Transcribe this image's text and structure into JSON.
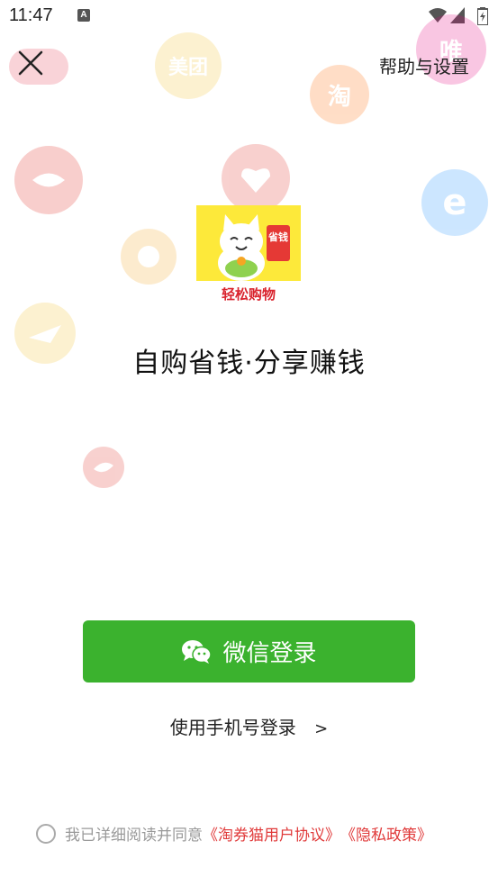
{
  "status_bar": {
    "time": "11:47",
    "notification": "A"
  },
  "header": {
    "help_label": "帮助与设置"
  },
  "background_icons": [
    {
      "name": "meituan-icon",
      "text": "美团",
      "color": "#f2c12e"
    },
    {
      "name": "taobao-icon",
      "text": "淘",
      "color": "#ff6a00"
    },
    {
      "name": "vip-icon",
      "text": "唯",
      "color": "#e6007e"
    },
    {
      "name": "jd-icon",
      "text": "",
      "color": "#e1251b"
    },
    {
      "name": "pinduoduo-icon",
      "text": "",
      "color": "#e02e24"
    },
    {
      "name": "eleme-icon",
      "text": "e",
      "color": "#1e90ff"
    },
    {
      "name": "suning-icon",
      "text": "",
      "color": "#f5a623"
    },
    {
      "name": "fliggy-icon",
      "text": "",
      "color": "#f2c12e"
    },
    {
      "name": "bird-icon",
      "text": "",
      "color": "#e02e24"
    }
  ],
  "logo": {
    "top_text": "省钱",
    "caption": "轻松购物"
  },
  "slogan": "自购省钱·分享赚钱",
  "wechat_login": {
    "label": "微信登录"
  },
  "phone_login": {
    "label": "使用手机号登录",
    "arrow": ">"
  },
  "agreement": {
    "text": "我已详细阅读并同意",
    "user_agreement": "《淘券猫用户协议》",
    "privacy_policy": "《隐私政策》"
  },
  "colors": {
    "wechat_green": "#3bb22e",
    "link_red": "#e03a3a"
  }
}
